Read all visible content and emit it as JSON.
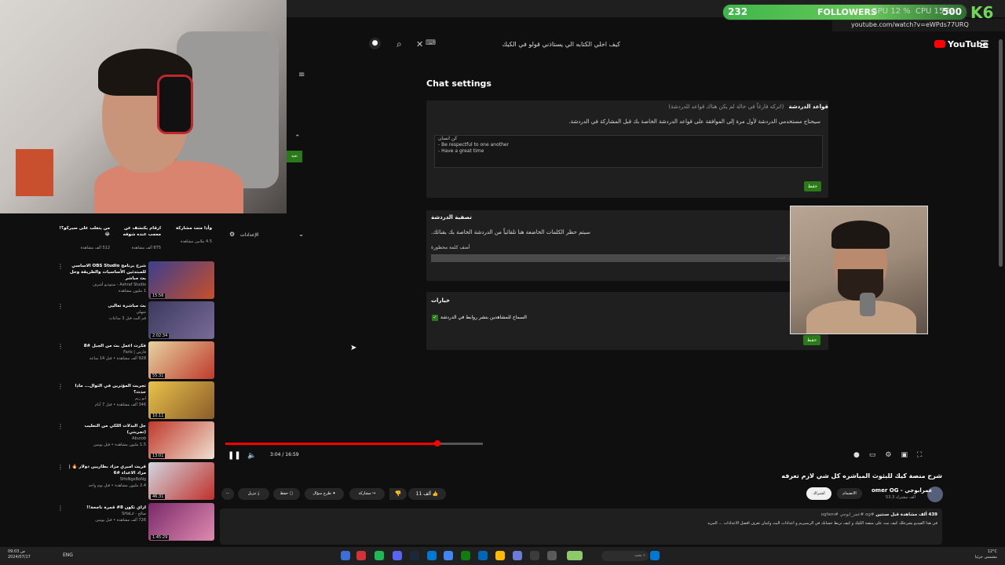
{
  "browser": {
    "url": "youtube.com/watch?v=eWPds77URQ"
  },
  "overlay": {
    "followers_count": "232",
    "followers_label": "FOLLOWERS",
    "followers_goal": "500",
    "gpu": "GPU 12 %",
    "cpu": "CPU 15 %",
    "brand": "K6"
  },
  "youtube": {
    "logo": "YouTube",
    "search_value": "كيف اخلي الكتابه الي يستاذني قولو في الكيك"
  },
  "chat_settings": {
    "title": "Chat settings",
    "rules": {
      "heading": "قواعد الدردشة",
      "hint": "(اتركه فارغاً في حالة لم يكن هناك قواعد للدردشة)",
      "description": "سيحتاج مستخدمي الدردشة لأول مرة إلى الموافقة على قواعد الدردشة الخاصة بك قبل المشاركة في الدردشة.",
      "lines": [
        "كن انسان",
        "- Be respectful to one another",
        "- Have a great time"
      ],
      "save": "حفظ"
    },
    "filter": {
      "title": "تصفية الدردشة",
      "description": "سيتم حظر الكلمات الخاضعة هنا تلقائياً من الدردشة الخاصة بك بقنائك.",
      "add_label": "أضف كلمة محظورة",
      "placeholder": "أدخل كلمات"
    },
    "options": {
      "title": "خيارات",
      "allow_links": "السماح للمشاهدين بنشر روابط في الدردشة",
      "save": "حفظ"
    }
  },
  "studio": {
    "settings_label": "الإعدادات",
    "badge": "تعيد"
  },
  "player": {
    "time": "3:04 / 16:59"
  },
  "video": {
    "title": "شرح منصة كيك للبثوث المباشره كل شي لازم تعرفه",
    "channel": "omer OG - عمرابوجي",
    "subs": "53.3 ألف مشترك",
    "join": "الانضمام",
    "subscribe": "اشتراك",
    "likes": "11 ألف",
    "share": "مشاركة",
    "ask": "طرح سؤال",
    "save": "حفظ",
    "download": "تنزيل",
    "stats": "439 ألف مشاهدة قبل سنتين",
    "tags": "#og #عمر_ابوجي #ogfam",
    "description": "في هذا الفيديو بشرحلك كيف تبث على منصة الكيك و كيف تربط حسابك في الرسيريم و اعدادات البث وكمان تعرف افضل الاعدادات ... المزيد"
  },
  "recommendations": [
    {
      "title": "شرح برنامج OBS Studio الاساسي للمبتدئين الأساسيات والطريقة وحل بث مباشر",
      "channel": "Ashraf Studio - ستوديو أشرف",
      "views": "1 مليون مشاهدة",
      "duration": "15:56"
    },
    {
      "title": "بث مباشرة تعاليى",
      "channel": "شهلي",
      "views": "قم البث قبل 3 ساعات",
      "duration": "2:02:34"
    },
    {
      "title": "فكرت اعمل بث من الجبل #8",
      "channel": "فارس | Faris",
      "views": "928 ألف مشاهدة • قبل 14 ساعة",
      "duration": "55:31"
    },
    {
      "title": "تجربت المؤثرين في الثوال... ماذا حدث؟",
      "channel": "ابو ريم",
      "views": "346 ألف مشاهدة • قبل 7 أيام",
      "duration": "10:11"
    },
    {
      "title": "جل البدلات اللكي من التعليب (تجربتي)",
      "channel": "Aburob",
      "views": "1.5 مليون مشاهدة • قبل يومين",
      "duration": "13:01"
    },
    {
      "title": "قريت امبري مزاد بطاريين دولار 🔥 | مزاد الاعداء #6",
      "channel": "SHoNgxBoNg",
      "views": "2.4 مليون مشاهدة • قبل يوم واحد",
      "duration": "46:31"
    },
    {
      "title": "ازاي تكون 8# قمرة ناجحة!!",
      "channel": "صالح - SHaLz",
      "views": "726 ألف مشاهدة • قبل يومين",
      "duration": "1:45:29"
    }
  ],
  "top_cards": [
    {
      "title": "وأذا متت مشاركة",
      "views": "4.5 ملايين مشاهدة"
    },
    {
      "title": "ارقام يكتشف عن معجب عنده شوفه",
      "views": "875 ألف مشاهدة"
    },
    {
      "title": "من يتغلب على سيركو؟! 😂",
      "views": "512 ألف مشاهدة"
    }
  ],
  "taskbar": {
    "time": "09:03 ص",
    "date": "2024/07/17",
    "lang": "ENG",
    "search": "بحث",
    "weather": "12°C",
    "weather_desc": "مشمس جزئيا"
  },
  "colors": {
    "accent_green": "#2a7a19",
    "progress_red": "#ff0000",
    "followers_green": "#3fb64a"
  }
}
